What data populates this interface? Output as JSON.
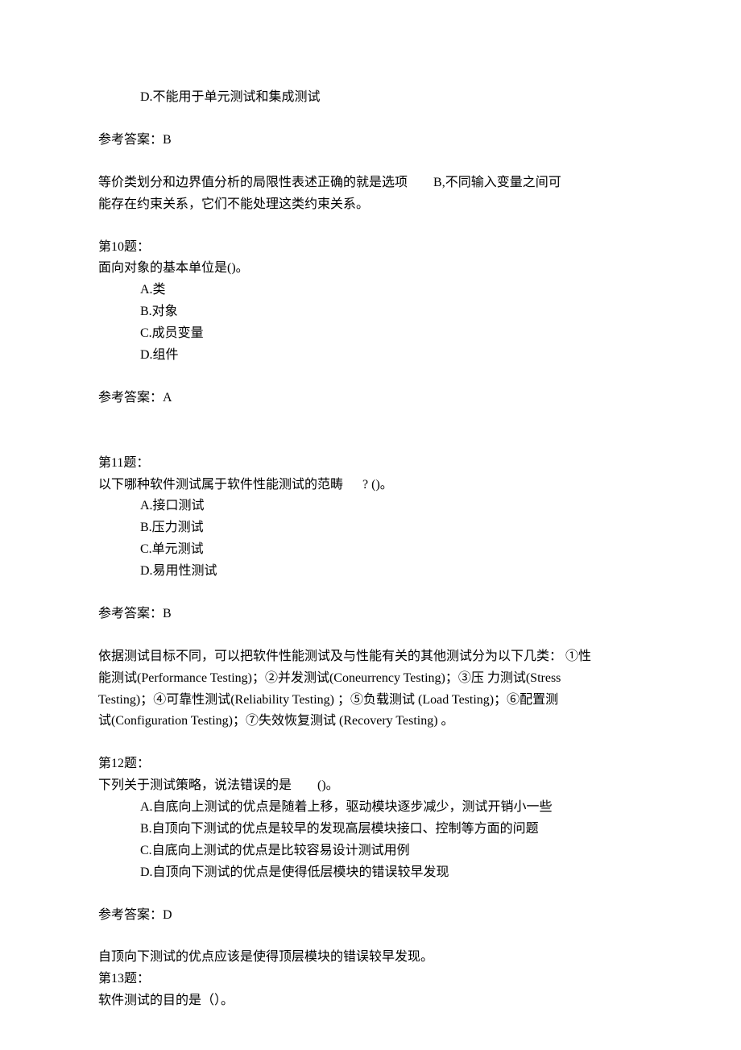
{
  "top": {
    "optD": "D.不能用于单元测试和集成测试",
    "ans": "参考答案：B",
    "exp_a": "等价类划分和边界值分析的局限性表述正确的就是选项",
    "exp_b": "B,不同输入变量之间可",
    "exp_c": "能存在约束关系，它们不能处理这类约束关系。"
  },
  "q10": {
    "title": "第10题：",
    "stem": "面向对象的基本单位是()。",
    "optA": "A.类",
    "optB": "B.对象",
    "optC": "C.成员变量",
    "optD": "D.组件",
    "ans": "参考答案：A"
  },
  "q11": {
    "title": "第11题：",
    "stem_a": "以下哪种软件测试属于软件性能测试的范畴",
    "stem_b": "? ()。",
    "optA": "A.接口测试",
    "optB": "B.压力测试",
    "optC": "C.单元测试",
    "optD": "D.易用性测试",
    "ans": "参考答案：B",
    "exp1": "依据测试目标不同，可以把软件性能测试及与性能有关的其他测试分为以下几类： ①性",
    "exp2": "能测试(Performance Testing)；②并发测试(Coneurrency Testing)；③压 力测试(Stress",
    "exp3": "Testing)；④可靠性测试(Reliability Testing) ；⑤负载测试 (Load Testing)；⑥配置测",
    "exp4": "试(Configuration Testing)；⑦失效恢复测试 (Recovery Testing) 。"
  },
  "q12": {
    "title": "第12题：",
    "stem_a": "下列关于测试策略，说法错误的是",
    "stem_b": "()。",
    "optA": "A.自底向上测试的优点是随着上移，驱动模块逐步减少，测试开销小一些",
    "optB": "B.自顶向下测试的优点是较早的发现高层模块接口、控制等方面的问题",
    "optC": "C.自底向上测试的优点是比较容易设计测试用例",
    "optD": "D.自顶向下测试的优点是使得低层模块的错误较早发现",
    "ans": "参考答案：D",
    "exp": "自顶向下测试的优点应该是使得顶层模块的错误较早发现。"
  },
  "q13": {
    "title": "第13题：",
    "stem": "软件测试的目的是（）。"
  }
}
